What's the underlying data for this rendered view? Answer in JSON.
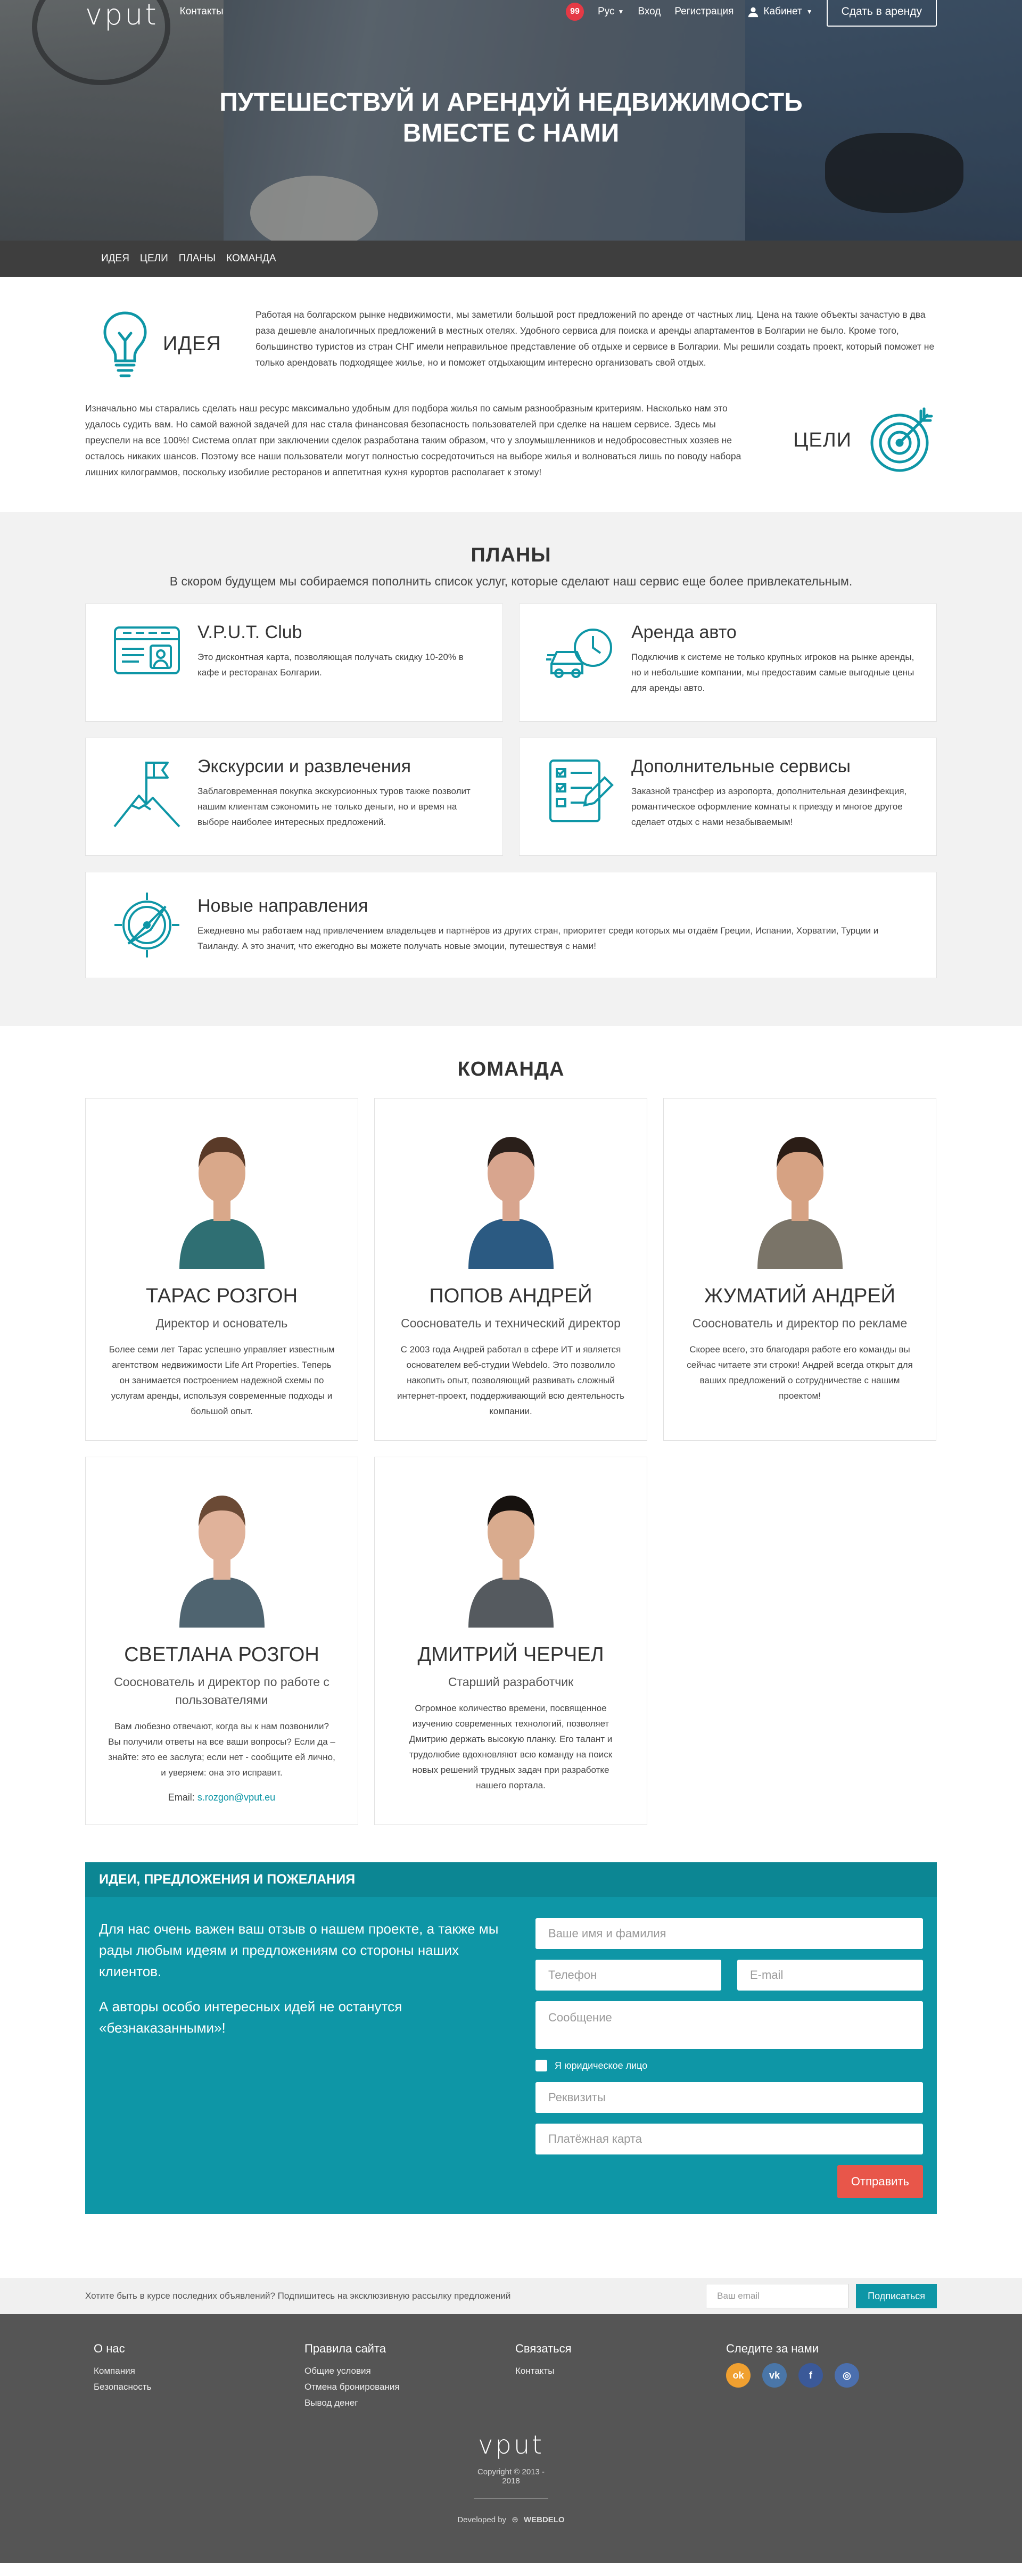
{
  "header": {
    "logo": "vput",
    "contacts": "Контакты",
    "badge_count": "99",
    "lang": "Рус",
    "login": "Вход",
    "register": "Регистрация",
    "cabinet": "Кабинет",
    "rent_button": "Сдать в аренду"
  },
  "hero": {
    "title_line1": "Путешествуй и арендуй недвижимость",
    "title_line2": "вместе с нами"
  },
  "subnav": [
    "Идея",
    "Цели",
    "Планы",
    "Команда"
  ],
  "idea": {
    "heading": "Идея",
    "text": "Работая на болгарском рынке недвижимости, мы заметили большой рост предложений по аренде от частных лиц. Цена на такие объекты зачастую в два раза дешевле аналогичных предложений в местных отелях. Удобного сервиса для поиска и аренды апартаментов в Болгарии не было. Кроме того, большинство туристов из стран СНГ имели неправильное представление об отдыхе и сервисе в Болгарии. Мы решили создать проект, который поможет не только арендовать подходящее жилье, но и поможет отдыхающим интересно организовать свой отдых."
  },
  "goals": {
    "heading": "Цели",
    "text": "Изначально мы старались сделать наш ресурс максимально удобным для подбора жилья по самым разнообразным критериям. Насколько нам это удалось судить вам. Но самой важной задачей для нас стала финансовая безопасность пользователей при сделке на нашем сервисе. Здесь мы преуспели на все 100%! Система оплат при заключении сделок разработана таким образом, что у злоумышленников и недобросовестных хозяев не осталось никаких шансов. Поэтому все наши пользователи могут полностью сосредоточиться на выборе жилья и волноваться лишь по поводу набора лишних килограммов, поскольку изобилие ресторанов и аппетитная кухня курортов располагает к этому!"
  },
  "plans": {
    "title": "Планы",
    "subtitle": "В скором будущем мы собираемся пополнить список услуг, которые сделают наш сервис еще более привлекательным.",
    "items": [
      {
        "icon": "club-card-icon",
        "title": "V.P.U.T. Club",
        "text": "Это дисконтная карта, позволяющая получать скидку 10-20% в кафе и ресторанах Болгарии."
      },
      {
        "icon": "car-clock-icon",
        "title": "Аренда авто",
        "text": "Подключив к системе не только крупных игроков на рынке аренды, но и небольшие компании, мы предоставим самые выгодные цены для аренды авто."
      },
      {
        "icon": "mountain-flag-icon",
        "title": "Экскурсии и развлечения",
        "text": "Заблаговременная покупка экскурсионных туров также позволит нашим клиентам сэкономить не только деньги, но и время на выборе наиболее интересных предложений."
      },
      {
        "icon": "checklist-icon",
        "title": "Дополнительные сервисы",
        "text": "Заказной трансфер из аэропорта, дополнительная дезинфекция, романтическое оформление комнаты к приезду и многое другое сделает отдых с нами незабываемым!"
      },
      {
        "icon": "compass-icon",
        "title": "Новые направления",
        "text": "Ежедневно мы работаем над привлечением владельцев и партнёров из других стран, приоритет среди которых мы отдаём Греции, Испании, Хорватии, Турции и Таиланду. А это значит, что ежегодно вы можете получать новые эмоции, путешествуя с нами!"
      }
    ]
  },
  "team": {
    "title": "Команда",
    "members": [
      {
        "name": "Тарас Розгон",
        "role": "Директор и основатель",
        "bio": "Более семи лет Тарас успешно управляет известным агентством недвижимости Life Art Properties. Теперь он занимается построением надежной схемы по услугам аренды, используя современные подходы и большой опыт.",
        "shirt": "#2f6f73",
        "skin": "#d9a88a",
        "hair": "#5a3a28"
      },
      {
        "name": "Попов Андрей",
        "role": "Сооснователь и технический директор",
        "bio": "С 2003 года Андрей работал в сфере ИТ и является основателем веб-студии Webdelo. Это позволило накопить опыт, позволяющий развивать сложный интернет-проект, поддерживающий всю деятельность компании.",
        "shirt": "#2b5a82",
        "skin": "#d8a58e",
        "hair": "#2a1f1a"
      },
      {
        "name": "Жуматий Андрей",
        "role": "Сооснователь и директор по рекламе",
        "bio": "Скорее всего, это благодаря работе его команды вы сейчас читаете эти строки! Андрей всегда открыт для ваших предложений о сотрудничестве с нашим проектом!",
        "shirt": "#7a7468",
        "skin": "#d6a283",
        "hair": "#2b1d16"
      },
      {
        "name": "Светлана Розгон",
        "role": "Сооснователь и директор по работе с пользователями",
        "bio": "Вам любезно отвечают, когда вы к нам позвонили? Вы получили ответы на все ваши вопросы? Если да – знайте: это ее заслуга; если нет - сообщите ей лично, и уверяем: она это исправит.",
        "email_label": "Email:",
        "email": "s.rozgon@vput.eu",
        "shirt": "#4f6470",
        "skin": "#e0b29a",
        "hair": "#6b4a35"
      },
      {
        "name": "Дмитрий Черчел",
        "role": "Старший разработчик",
        "bio": "Огромное количество времени, посвященное изучению современных технологий, позволяет Дмитрию держать высокую планку. Его талант и трудолюбие вдохновляют всю команду на поиск новых решений трудных задач при разработке нашего портала.",
        "shirt": "#555a5f",
        "skin": "#d9ab8e",
        "hair": "#17120f"
      }
    ]
  },
  "feedback": {
    "title": "Идеи, предложения и пожелания",
    "text1": "Для нас очень важен ваш отзыв о нашем проекте, а также мы рады любым идеям и предложениям со стороны наших клиентов.",
    "text2": "А авторы особо интересных идей не останутся «безнаказанными»!",
    "name_ph": "Ваше имя и фамилия",
    "phone_ph": "Телефон",
    "email_ph": "E-mail",
    "message_ph": "Сообщение",
    "legal_label": "Я юридическое лицо",
    "requisites_ph": "Реквизиты",
    "card_ph": "Платёжная карта",
    "submit": "Отправить"
  },
  "subscribe": {
    "text": "Хотите быть в курсе последних объявлений? Подпишитесь на эксклюзивную рассылку предложений",
    "email_ph": "Ваш email",
    "button": "Подписаться"
  },
  "footer": {
    "about_title": "О нас",
    "about_links": [
      "Компания",
      "Безопасность"
    ],
    "rules_title": "Правила сайта",
    "rules_links": [
      "Общие условия",
      "Отмена бронирования",
      "Вывод денег"
    ],
    "contact_title": "Связаться",
    "contact_links": [
      "Контакты"
    ],
    "follow_title": "Следите за нами",
    "logo": "vput",
    "copyright": "Copyright © 2013 - 2018",
    "developed": "Developed by",
    "developer": "WEBDELO"
  },
  "colors": {
    "accent": "#0e96a6",
    "submit": "#e8564a",
    "badge": "#e53945",
    "footer": "#555555",
    "subnav": "#3e3e3e"
  }
}
